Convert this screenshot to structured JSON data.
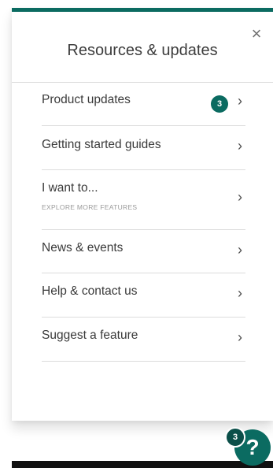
{
  "panel": {
    "title": "Resources & updates",
    "close_glyph": "×"
  },
  "menu": {
    "chevron_glyph": "›",
    "items": [
      {
        "label": "Product updates",
        "badge": "3"
      },
      {
        "label": "Getting started guides"
      },
      {
        "label": "I want to...",
        "sublabel": "EXPLORE MORE FEATURES"
      },
      {
        "label": "News & events"
      },
      {
        "label": "Help & contact us"
      },
      {
        "label": "Suggest a feature"
      }
    ]
  },
  "help": {
    "glyph": "?",
    "badge": "3"
  },
  "colors": {
    "accent": "#0b6b61",
    "divider": "#dcdcdc",
    "text": "#3a3a3a"
  },
  "icons": {
    "close": "close-icon",
    "chevron": "chevron-right-icon",
    "help": "question-mark-icon"
  }
}
